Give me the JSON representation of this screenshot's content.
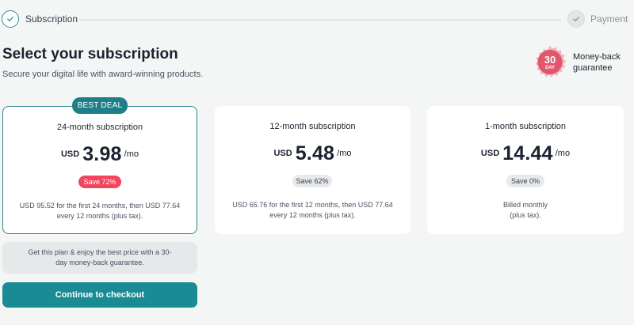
{
  "stepper": {
    "steps": [
      {
        "label": "Subscription",
        "state": "completed"
      },
      {
        "label": "Payment",
        "state": "pending"
      }
    ],
    "check_icon": "check-icon",
    "accent": "#2f8f95"
  },
  "header": {
    "title": "Select your subscription",
    "subtitle": "Secure your digital life with award-winning products."
  },
  "guarantee": {
    "badge_number": "30",
    "badge_unit": "DAY",
    "line1": "Money-back",
    "line2": "guarantee",
    "badge_color": "#e0566b"
  },
  "plans": [
    {
      "name": "24-month subscription",
      "currency": "USD",
      "price": "3.98",
      "period": "/mo",
      "save": "Save 72%",
      "billing_line1": "USD 95.52 for the first 24 months, then USD 77.64",
      "billing_line2": "every 12 months (plus tax).",
      "selected": true,
      "ribbon": "BEST DEAL"
    },
    {
      "name": "12-month subscription",
      "currency": "USD",
      "price": "5.48",
      "period": "/mo",
      "save": "Save 62%",
      "billing_line1": "USD 65.76 for the first 12 months, then USD 77.64",
      "billing_line2": "every 12 months (plus tax).",
      "selected": false
    },
    {
      "name": "1-month subscription",
      "currency": "USD",
      "price": "14.44",
      "period": "/mo",
      "save": "Save 0%",
      "billing_line1": "Billed monthly",
      "billing_line2": "(plus tax).",
      "selected": false
    }
  ],
  "promo": {
    "text": "Get this plan & enjoy the best price with a 30-day money-back guarantee."
  },
  "checkout": {
    "label": "Continue to checkout",
    "color": "#1a8a94"
  },
  "colors": {
    "background": "#f4f5f5",
    "selected_border": "#2a868c",
    "save_highlight": "#f2455e"
  }
}
